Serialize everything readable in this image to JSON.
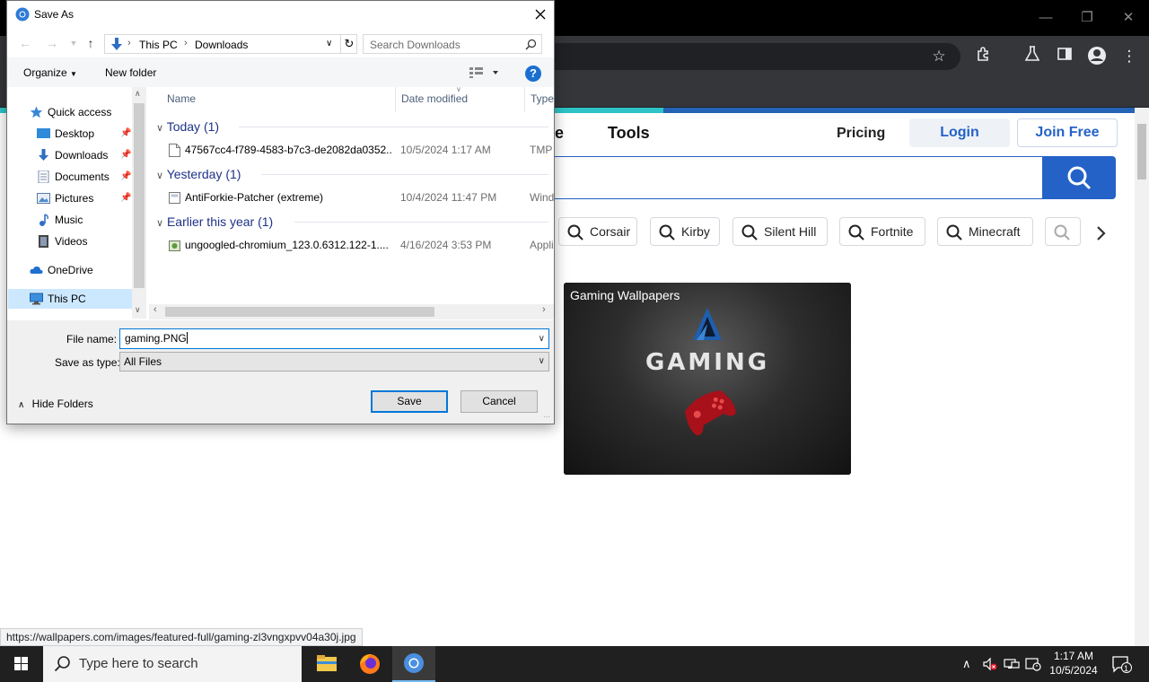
{
  "browser": {
    "progress": 0.585,
    "nav": {
      "partial_left": "ore",
      "tools": "Tools",
      "pricing": "Pricing",
      "login": "Login",
      "join": "Join Free"
    },
    "chips": [
      "Corsair",
      "Kirby",
      "Silent Hill",
      "Fortnite",
      "Minecraft"
    ],
    "card": {
      "title": "Gaming Wallpapers",
      "logo_text": "GAMING"
    },
    "status_url": "https://wallpapers.com/images/featured-full/gaming-zl3vngxpvv04a30j.jpg"
  },
  "dialog": {
    "title": "Save As",
    "breadcrumb": [
      "This PC",
      "Downloads"
    ],
    "search_placeholder": "Search Downloads",
    "organize_label": "Organize",
    "new_folder_label": "New folder",
    "nav_items": [
      {
        "label": "Quick access",
        "icon": "star-icon"
      },
      {
        "label": "Desktop",
        "icon": "desktop-folder-icon",
        "pinned": true
      },
      {
        "label": "Downloads",
        "icon": "download-arrow-icon",
        "pinned": true
      },
      {
        "label": "Documents",
        "icon": "documents-icon",
        "pinned": true
      },
      {
        "label": "Pictures",
        "icon": "pictures-icon",
        "pinned": true
      },
      {
        "label": "Music",
        "icon": "music-icon"
      },
      {
        "label": "Videos",
        "icon": "videos-icon"
      },
      {
        "label": "OneDrive",
        "icon": "cloud-icon"
      },
      {
        "label": "This PC",
        "icon": "computer-icon",
        "selected": true
      }
    ],
    "columns": [
      "Name",
      "Date modified",
      "Type"
    ],
    "groups": [
      {
        "heading": "Today (1)",
        "files": [
          {
            "name": "47567cc4-f789-4583-b7c3-de2082da0352....",
            "date": "10/5/2024 1:17 AM",
            "type": "TMP"
          }
        ]
      },
      {
        "heading": "Yesterday (1)",
        "files": [
          {
            "name": "AntiForkie-Patcher (extreme)",
            "date": "10/4/2024 11:47 PM",
            "type": "Wind"
          }
        ]
      },
      {
        "heading": "Earlier this year (1)",
        "files": [
          {
            "name": "ungoogled-chromium_123.0.6312.122-1....",
            "date": "4/16/2024 3:53 PM",
            "type": "Appli"
          }
        ]
      }
    ],
    "file_name_label": "File name:",
    "file_name_value": "gaming.PNG",
    "save_type_label": "Save as type:",
    "save_type_value": "All Files",
    "hide_folders_label": "Hide Folders",
    "save_label": "Save",
    "cancel_label": "Cancel"
  },
  "taskbar": {
    "search_placeholder": "Type here to search",
    "time": "1:17 AM",
    "date": "10/5/2024",
    "notification_count": "1"
  },
  "colors": {
    "accent": "#2462c7",
    "dialog_selection": "#cce8ff",
    "progress": "#2ec4c7"
  }
}
